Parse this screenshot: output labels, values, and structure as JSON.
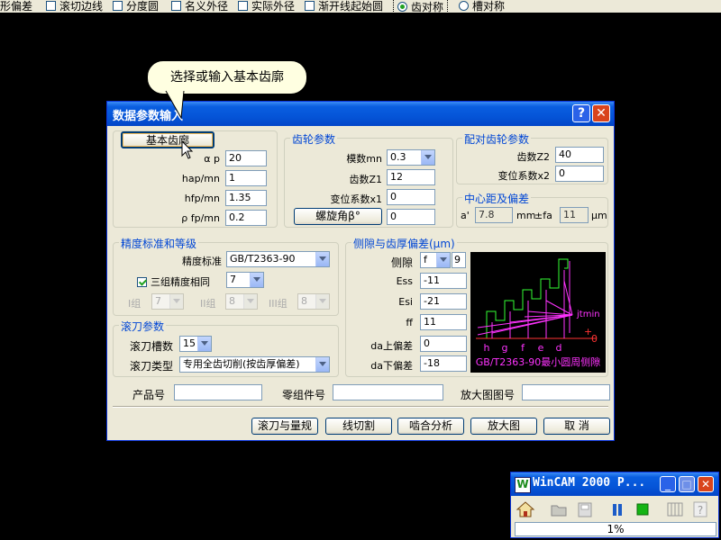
{
  "top_options": [
    {
      "label": "齿形偏差",
      "type": "checkbox",
      "checked": false
    },
    {
      "label": "滚切边线",
      "type": "checkbox",
      "checked": false
    },
    {
      "label": "分度圆",
      "type": "checkbox",
      "checked": false
    },
    {
      "label": "名义外径",
      "type": "checkbox",
      "checked": false
    },
    {
      "label": "实际外径",
      "type": "checkbox",
      "checked": false
    },
    {
      "label": "渐开线起始圆",
      "type": "checkbox",
      "checked": false
    },
    {
      "label": "齿对称",
      "type": "radio",
      "checked": true
    },
    {
      "label": "槽对称",
      "type": "radio",
      "checked": false
    }
  ],
  "tooltip": {
    "text": "选择或输入基本齿廓"
  },
  "dialog": {
    "title": "数据参数输入",
    "help_label": "?",
    "close_label": "✕",
    "basic_profile": {
      "button_label": "基本齿廓",
      "fields": [
        {
          "label": "α p",
          "value": "20"
        },
        {
          "label": "hap/mn",
          "value": "1"
        },
        {
          "label": "hfp/mn",
          "value": "1.35"
        },
        {
          "label": "ρ fp/mn",
          "value": "0.2"
        }
      ]
    },
    "gear": {
      "title": "齿轮参数",
      "module_label": "模数mn",
      "module_value": "0.3",
      "teeth_label": "齿数Z1",
      "teeth_value": "12",
      "shift_label": "变位系数x1",
      "shift_value": "0",
      "helix_button": "螺旋角β°",
      "helix_value": "0"
    },
    "mate": {
      "title": "配对齿轮参数",
      "teeth_label": "齿数Z2",
      "teeth_value": "40",
      "shift_label": "变位系数x2",
      "shift_value": "0"
    },
    "center": {
      "title": "中心距及偏差",
      "a_label": "a'",
      "a_value": "7.8",
      "a_unit": "mm",
      "fa_label": "±fa",
      "fa_value": "11",
      "fa_unit": "μm"
    },
    "precision": {
      "title": "精度标准和等级",
      "standard_label": "精度标准",
      "standard_value": "GB/T2363-90",
      "same_label": "三组精度相同",
      "same_checked": true,
      "same_value": "7",
      "g1_label": "I组",
      "g1_value": "7",
      "g2_label": "II组",
      "g2_value": "8",
      "g3_label": "III组",
      "g3_value": "8"
    },
    "hob": {
      "title": "滚刀参数",
      "slots_label": "滚刀槽数",
      "slots_value": "15",
      "type_label": "滚刀类型",
      "type_value": "专用全齿切削(按齿厚偏差)"
    },
    "backlash": {
      "title": "侧隙与齿厚偏差(μm)",
      "side_label": "侧隙",
      "side_value": "f",
      "side_extra": "9",
      "ess_label": "Ess",
      "ess_value": "-11",
      "esi_label": "Esi",
      "esi_value": "-21",
      "ff_label": "ff",
      "ff_value": "11",
      "da_up_label": "da上偏差",
      "da_up_value": "0",
      "da_down_label": "da下偏差",
      "da_down_value": "-18"
    },
    "backlash_chart": {
      "letters": [
        "h",
        "g",
        "f",
        "e",
        "d"
      ],
      "jtmin_label": "jtmin",
      "zero_label": "0",
      "plus_label": "+",
      "caption": "GB/T2363-90最小圆周侧隙",
      "line_color": "#ff33ff",
      "step_color": "#33ff33",
      "axis_color": "#ff3333",
      "text_color": "#ff33ff"
    },
    "product": {
      "label": "产品号",
      "value": ""
    },
    "part": {
      "label": "零组件号",
      "value": ""
    },
    "enlarge_no": {
      "label": "放大图图号",
      "value": ""
    },
    "buttons": {
      "hob_gauge": "滚刀与量规",
      "wire_cut": "线切割",
      "mesh": "啮合分析",
      "enlarge": "放大图",
      "cancel": "取 消"
    }
  },
  "mini_window": {
    "title": "WinCAM 2000 P...",
    "logo": "W",
    "minimize": "_",
    "maximize": "□",
    "close": "✕",
    "progress": "1%",
    "tools": [
      "home-icon",
      "open-icon",
      "save-icon",
      "pause-icon",
      "stop-icon",
      "settings-icon",
      "help-icon"
    ]
  }
}
